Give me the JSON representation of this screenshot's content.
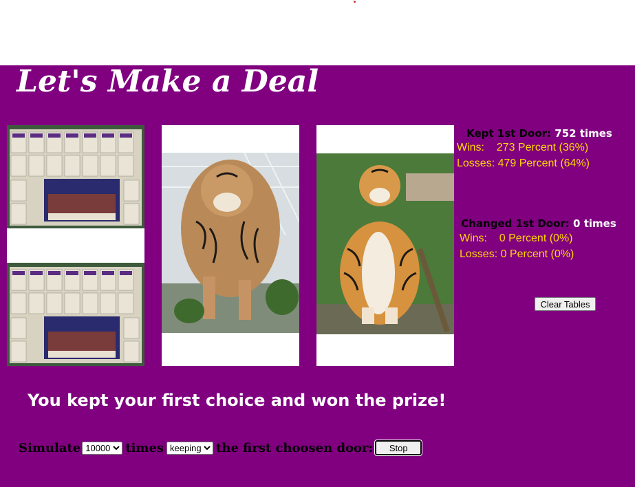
{
  "title": "Let's Make a Deal",
  "kept": {
    "heading": "Kept 1st Door:",
    "count": "752 times",
    "wins": "Wins:    273 Percent (36%)",
    "losses": "Losses: 479 Percent (64%)"
  },
  "changed": {
    "heading": "Changed 1st Door:",
    "count": "0 times",
    "wins": "Wins:    0 Percent (0%)",
    "losses": "Losses: 0 Percent (0%)"
  },
  "clear_label": "Clear Tables",
  "message": "You kept your first choice and won the prize!",
  "sim": {
    "prefix": "Simulate",
    "count_selected": "10000",
    "middle": "times",
    "mode_selected": "keeping",
    "suffix": "the first choosen door:",
    "stop_label": "Stop"
  },
  "colors": {
    "background": "#800080",
    "stat_text": "#ffd700",
    "heading_text": "#000000",
    "message_text": "#ffffff"
  },
  "doors": [
    {
      "icon": "lsu-tickets-collage-image"
    },
    {
      "icon": "walking-tiger-image"
    },
    {
      "icon": "sitting-tiger-image"
    }
  ]
}
